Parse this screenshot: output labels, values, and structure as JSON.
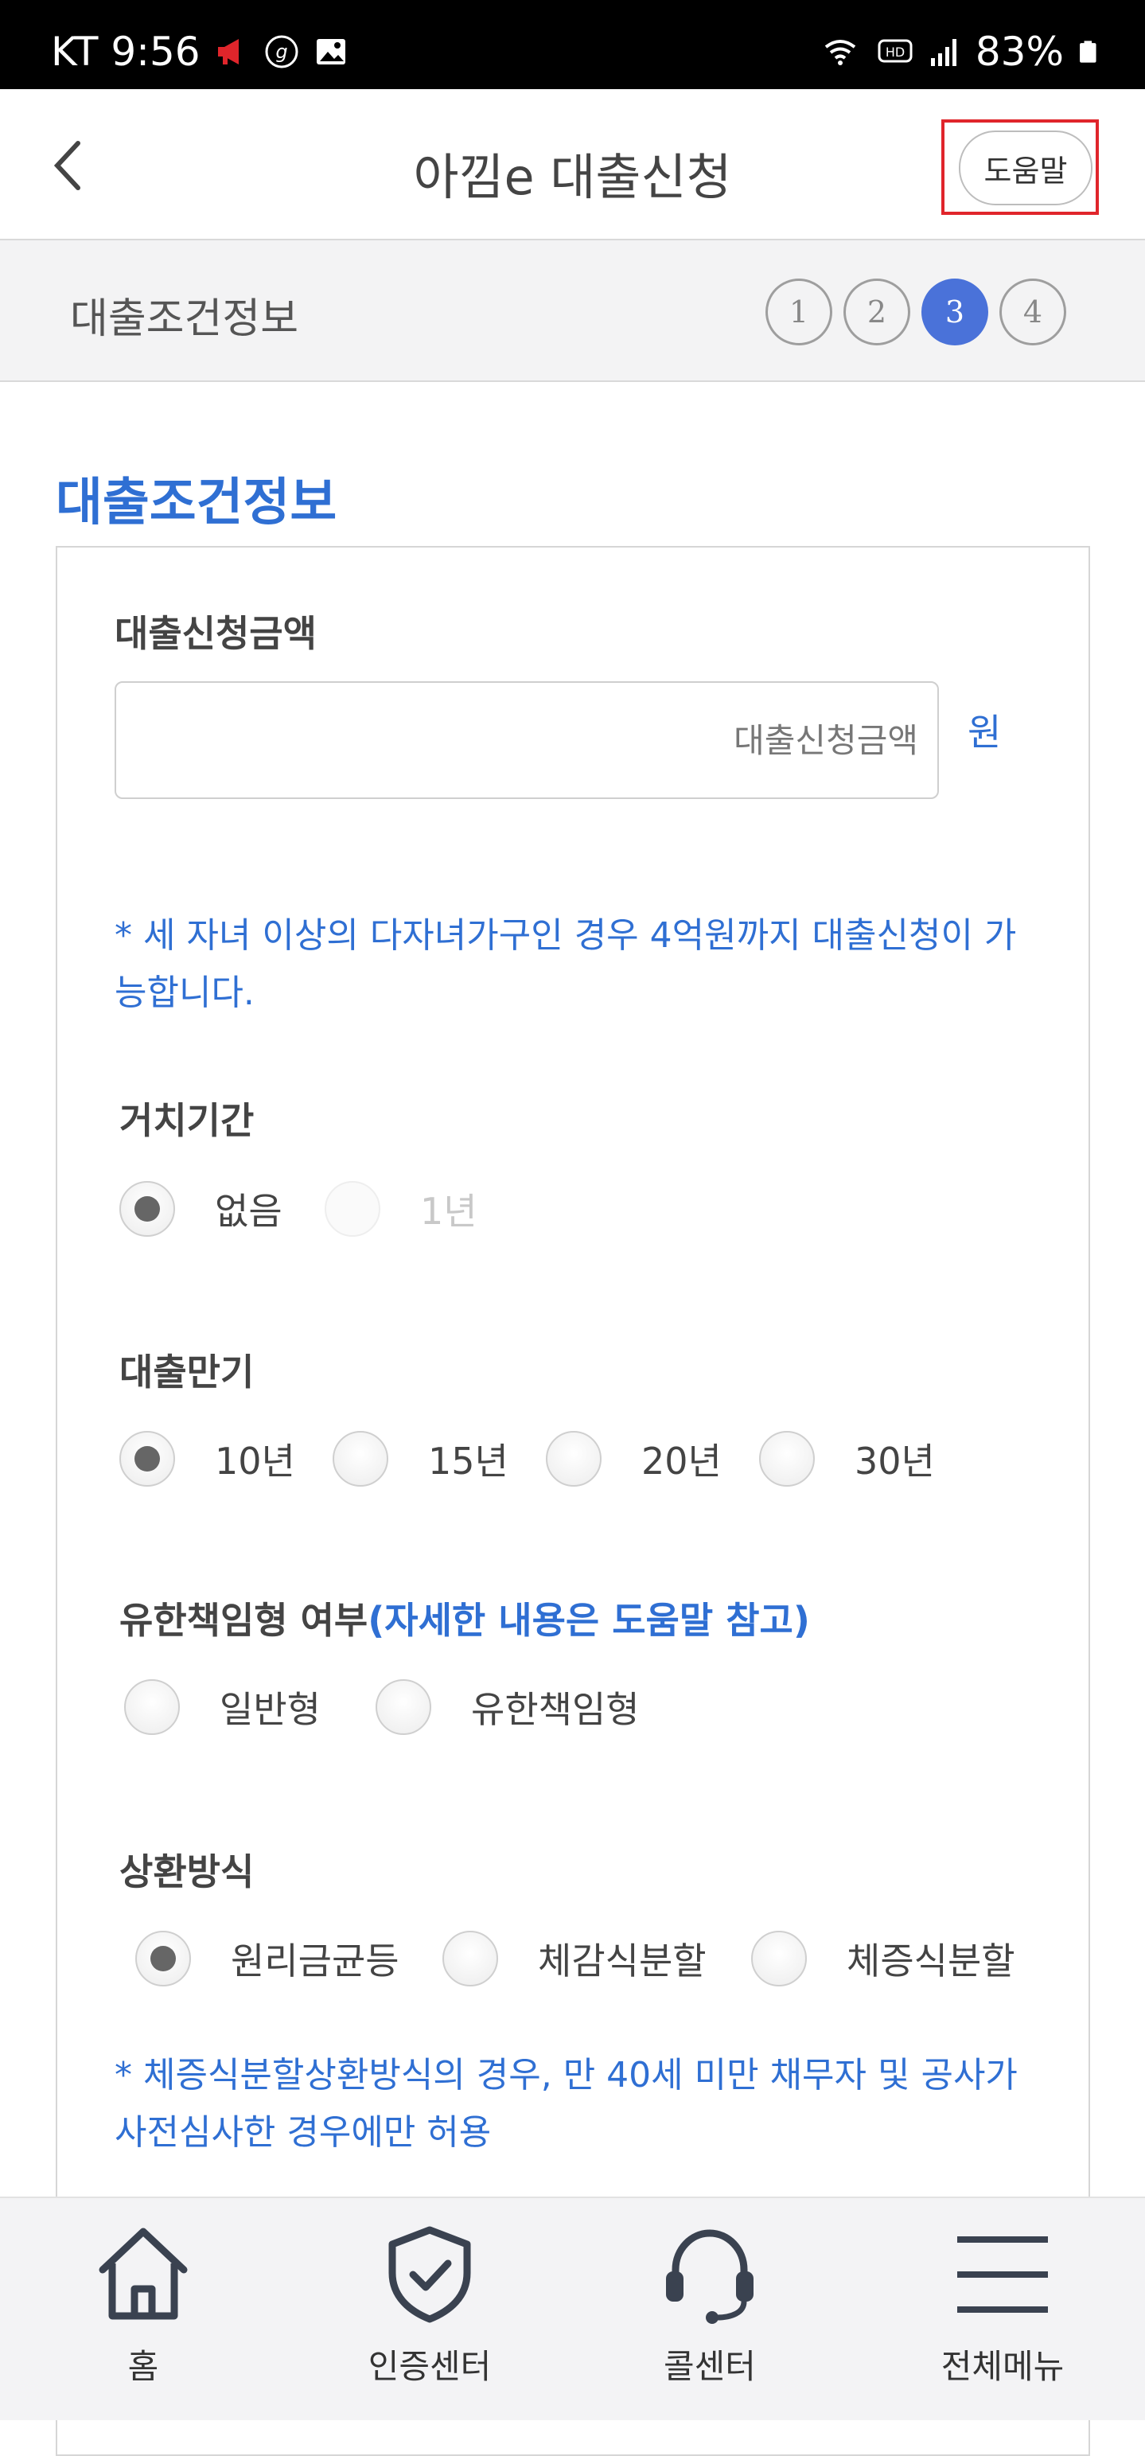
{
  "status_bar": {
    "carrier_time": "KT 9:56",
    "battery": "83%"
  },
  "header": {
    "title": "아낌e 대출신청",
    "help_label": "도움말"
  },
  "stepbar": {
    "title": "대출조건정보",
    "steps": [
      "1",
      "2",
      "3",
      "4"
    ],
    "active_step": 3
  },
  "section": {
    "title": "대출조건정보"
  },
  "loan_amount": {
    "label": "대출신청금액",
    "placeholder": "대출신청금액",
    "value": "",
    "unit": "원",
    "note": "* 세 자녀 이상의 다자녀가구인 경우 4억원까지 대출신청이 가능합니다."
  },
  "grace_period": {
    "label": "거치기간",
    "options": [
      "없음",
      "1년"
    ],
    "selected": "없음"
  },
  "loan_term": {
    "label": "대출만기",
    "options": [
      "10년",
      "15년",
      "20년",
      "30년"
    ],
    "selected": "10년"
  },
  "liability_type": {
    "label": "유한책임형 여부",
    "label_hint": "(자세한 내용은 도움말 참고)",
    "options": [
      "일반형",
      "유한책임형"
    ],
    "selected": ""
  },
  "repayment": {
    "label": "상환방식",
    "options": [
      "원리금균등",
      "체감식분할",
      "체증식분할"
    ],
    "selected": "원리금균등",
    "note": "* 체증식분할상환방식의 경우, 만 40세 미만 채무자 및 공사가 사전심사한 경우에만 허용"
  },
  "bottom_nav": {
    "items": [
      "홈",
      "인증센터",
      "콜센터",
      "전체메뉴"
    ]
  },
  "colors": {
    "accent": "#2f6fd3",
    "step_active": "#4a72d9",
    "help_highlight": "#e0252b"
  }
}
